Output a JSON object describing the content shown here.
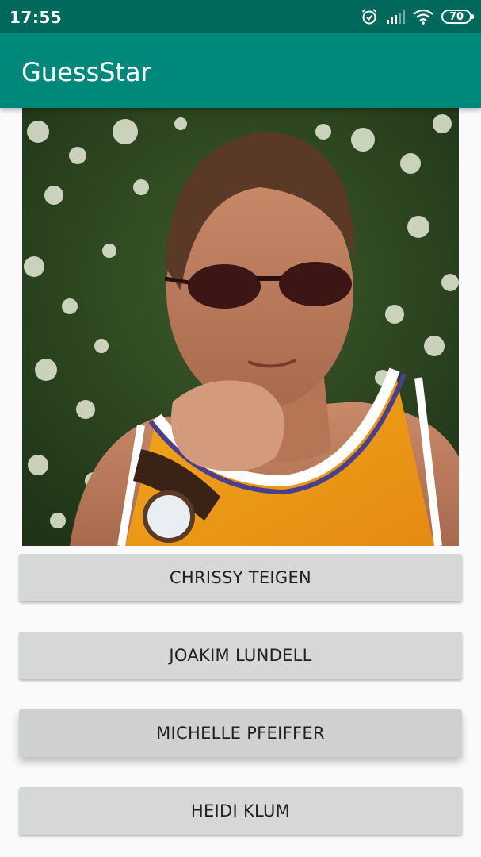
{
  "status_bar": {
    "time": "17:55",
    "battery_level": "70",
    "icons": [
      "alarm-icon",
      "cell-signal-icon",
      "wifi-icon",
      "battery-icon"
    ]
  },
  "app_bar": {
    "title": "GuessStar",
    "color": "#00897b",
    "status_color": "#00695c"
  },
  "celebrity_image": {
    "icon": "celebrity-photo"
  },
  "answers": [
    {
      "label": "CHRISSY TEIGEN"
    },
    {
      "label": "JOAKIM LUNDELL"
    },
    {
      "label": "MICHELLE PFEIFFER"
    },
    {
      "label": "HEIDI KLUM"
    }
  ]
}
